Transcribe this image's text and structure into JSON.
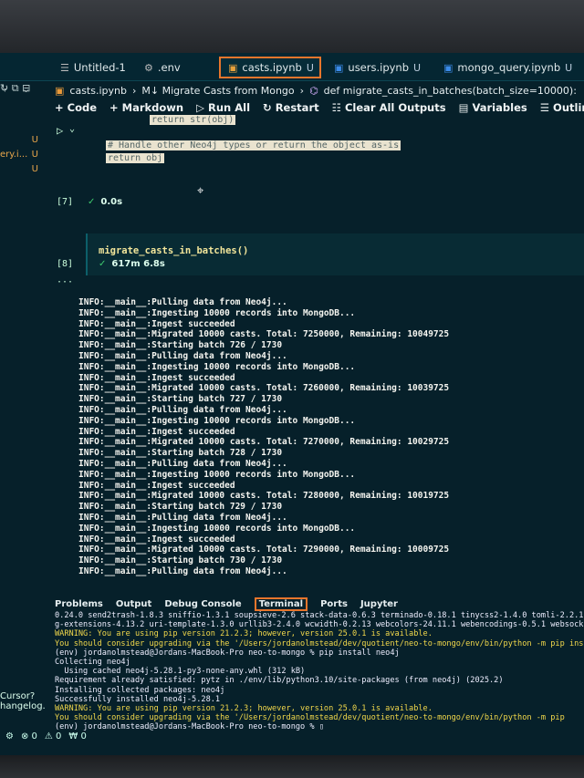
{
  "tabs": [
    {
      "label": "Untitled-1",
      "icon": "list-icon",
      "badge": ""
    },
    {
      "label": ".env",
      "icon": "gear-icon",
      "badge": ""
    },
    {
      "label": "casts.ipynb",
      "icon": "notebook-icon",
      "badge": "U"
    },
    {
      "label": "users.ipynb",
      "icon": "notebook-icon",
      "badge": "U"
    },
    {
      "label": "mongo_query.ipynb",
      "icon": "notebook-icon",
      "badge": "U"
    }
  ],
  "breadcrumb": [
    "casts.ipynb",
    "M↓ Migrate Casts from Mongo",
    "def migrate_casts_in_batches(batch_size=10000):"
  ],
  "toolbar": {
    "code": "+ Code",
    "markdown": "+ Markdown",
    "run_all": "Run All",
    "restart": "Restart",
    "clear": "Clear All Outputs",
    "variables": "Variables",
    "outline": "Outline",
    "more": "···"
  },
  "explorer": [
    {
      "name": "",
      "badge": "U"
    },
    {
      "name": "ery.i...",
      "badge": "U"
    },
    {
      "name": "",
      "badge": "U"
    }
  ],
  "cell1": {
    "lines": [
      "return str(obj)",
      "",
      "# Handle other Neo4j types or return the object as-is",
      "return obj"
    ],
    "exec": "[7]",
    "time": "0.0s"
  },
  "cell2": {
    "code": "migrate_casts_in_batches()",
    "exec": "[8]",
    "time": "617m 6.8s"
  },
  "output_lines": [
    "INFO:__main__:Pulling data from Neo4j...",
    "INFO:__main__:Ingesting 10000 records into MongoDB...",
    "INFO:__main__:Ingest succeeded",
    "INFO:__main__:Migrated 10000 casts. Total: 7250000, Remaining: 10049725",
    "INFO:__main__:Starting batch 726 / 1730",
    "INFO:__main__:Pulling data from Neo4j...",
    "INFO:__main__:Ingesting 10000 records into MongoDB...",
    "INFO:__main__:Ingest succeeded",
    "INFO:__main__:Migrated 10000 casts. Total: 7260000, Remaining: 10039725",
    "INFO:__main__:Starting batch 727 / 1730",
    "INFO:__main__:Pulling data from Neo4j...",
    "INFO:__main__:Ingesting 10000 records into MongoDB...",
    "INFO:__main__:Ingest succeeded",
    "INFO:__main__:Migrated 10000 casts. Total: 7270000, Remaining: 10029725",
    "INFO:__main__:Starting batch 728 / 1730",
    "INFO:__main__:Pulling data from Neo4j...",
    "INFO:__main__:Ingesting 10000 records into MongoDB...",
    "INFO:__main__:Ingest succeeded",
    "INFO:__main__:Migrated 10000 casts. Total: 7280000, Remaining: 10019725",
    "INFO:__main__:Starting batch 729 / 1730",
    "INFO:__main__:Pulling data from Neo4j...",
    "INFO:__main__:Ingesting 10000 records into MongoDB...",
    "INFO:__main__:Ingest succeeded",
    "INFO:__main__:Migrated 10000 casts. Total: 7290000, Remaining: 10009725",
    "INFO:__main__:Starting batch 730 / 1730",
    "INFO:__main__:Pulling data from Neo4j..."
  ],
  "panel_tabs": [
    "Problems",
    "Output",
    "Debug Console",
    "Terminal",
    "Ports",
    "Jupyter"
  ],
  "terminal_lines": [
    {
      "text": "0.24.0 send2trash-1.8.3 sniffio-1.3.1 soupsieve-2.6 stack-data-0.6.3 terminado-0.18.1 tinycss2-1.4.0 tomli-2.2.1",
      "warn": false
    },
    {
      "text": "g-extensions-4.13.2 uri-template-1.3.0 urllib3-2.4.0 wcwidth-0.2.13 webcolors-24.11.1 webencodings-0.5.1 websock",
      "warn": false
    },
    {
      "text": "WARNING: You are using pip version 21.2.3; however, version 25.0.1 is available.",
      "warn": true
    },
    {
      "text": "You should consider upgrading via the '/Users/jordanolmstead/dev/quotient/neo-to-mongo/env/bin/python -m pip ins",
      "warn": true
    },
    {
      "text": "(env) jordanolmstead@Jordans-MacBook-Pro neo-to-mongo % pip install neo4j",
      "warn": false
    },
    {
      "text": "Collecting neo4j",
      "warn": false
    },
    {
      "text": "  Using cached neo4j-5.28.1-py3-none-any.whl (312 kB)",
      "warn": false
    },
    {
      "text": "Requirement already satisfied: pytz in ./env/lib/python3.10/site-packages (from neo4j) (2025.2)",
      "warn": false
    },
    {
      "text": "Installing collected packages: neo4j",
      "warn": false
    },
    {
      "text": "Successfully installed neo4j-5.28.1",
      "warn": false
    },
    {
      "text": "WARNING: You are using pip version 21.2.3; however, version 25.0.1 is available.",
      "warn": true
    },
    {
      "text": "You should consider upgrading via the '/Users/jordanolmstead/dev/quotient/neo-to-mongo/env/bin/python -m pip",
      "warn": true
    },
    {
      "text": "(env) jordanolmstead@Jordans-MacBook-Pro neo-to-mongo % ▯",
      "warn": false
    }
  ],
  "cursor_tip": {
    "title": "Cursor?",
    "sub": "hangelog."
  },
  "statusbar": {
    "errors": "⊗ 0",
    "warnings": "⚠ 0",
    "ports": "₩ 0"
  }
}
